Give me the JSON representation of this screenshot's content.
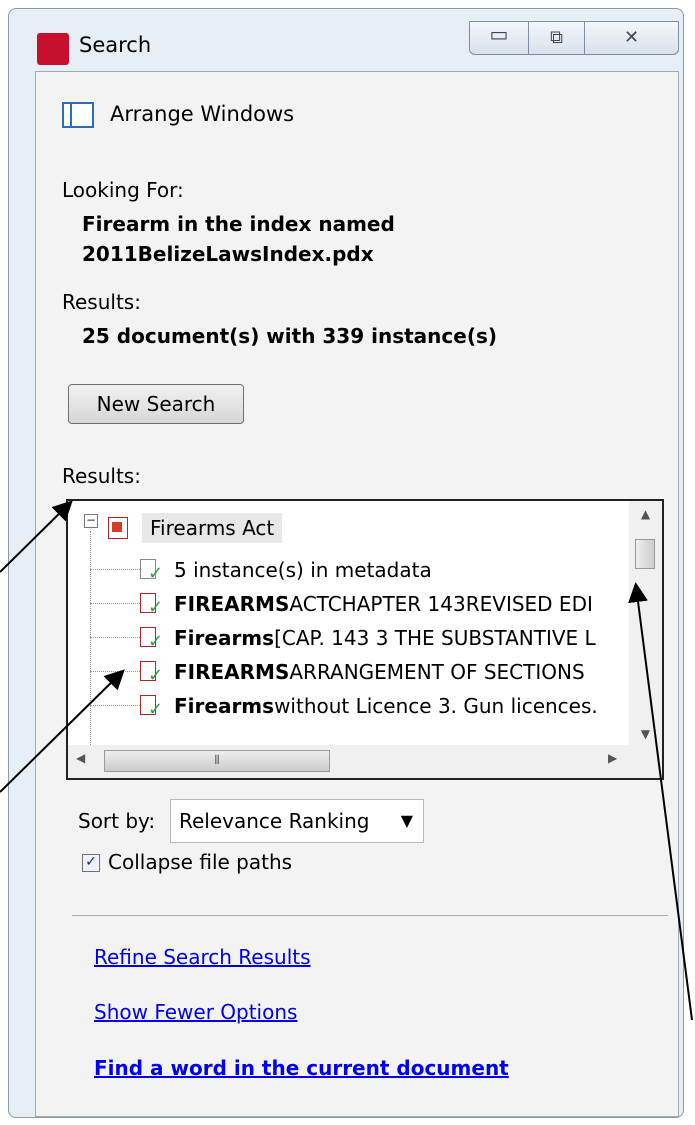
{
  "window": {
    "title": "Search",
    "controls": {
      "minimize": "▭",
      "maximize": "⧉",
      "close": "✕"
    }
  },
  "arrange": {
    "label": "Arrange Windows"
  },
  "looking_for": {
    "label": "Looking For:",
    "line1": "Firearm in the index named",
    "line2": "2011BelizeLawsIndex.pdx"
  },
  "results_summary": {
    "label": "Results:",
    "value": "25 document(s) with 339 instance(s)"
  },
  "new_search": {
    "label": "New Search"
  },
  "results_list": {
    "label": "Results:",
    "root": {
      "expander": "−",
      "label": "Firearms Act"
    },
    "items": [
      {
        "type": "meta",
        "bold": "",
        "text": "5 instance(s) in metadata"
      },
      {
        "type": "hit",
        "bold": "FIREARMS",
        "text": " ACTCHAPTER 143REVISED EDI"
      },
      {
        "type": "hit",
        "bold": "Firearms",
        "text": " [CAP. 143 3 THE SUBSTANTIVE L"
      },
      {
        "type": "hit",
        "bold": "FIREARMS",
        "text": " ARRANGEMENT OF SECTIONS"
      },
      {
        "type": "hit",
        "bold": "Firearms",
        "text": " without Licence 3. Gun licences."
      }
    ]
  },
  "sort": {
    "label": "Sort by:",
    "value": "Relevance Ranking"
  },
  "collapse": {
    "label": "Collapse file paths",
    "checked": true
  },
  "links": {
    "refine": "Refine Search Results",
    "fewer": "Show Fewer Options",
    "find_word": "Find a word in the current document"
  }
}
